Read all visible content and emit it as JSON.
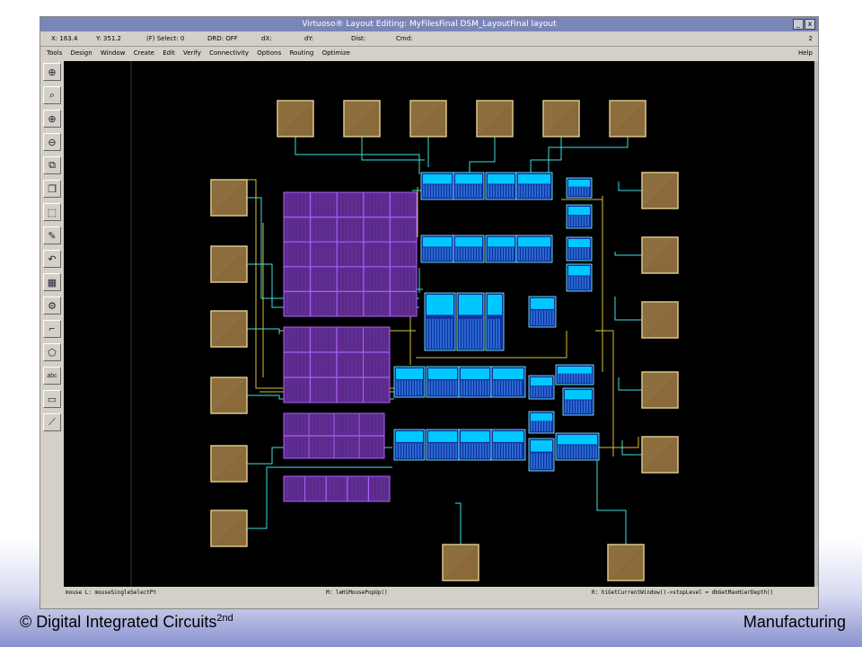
{
  "window": {
    "title": "Virtuoso® Layout Editing: MyFilesFinal DSM_LayoutFinal layout",
    "minimize_label": "_",
    "close_label": "x",
    "corner_number": "2"
  },
  "status": {
    "x": "X: 163.4",
    "y": "Y: 351.2",
    "select": "(F) Select: 0",
    "drd": "DRD: OFF",
    "dx": "dX:",
    "dy": "dY:",
    "dist": "Dist:",
    "cmd": "Cmd:"
  },
  "menu": {
    "items": [
      "Tools",
      "Design",
      "Window",
      "Create",
      "Edit",
      "Verify",
      "Connectivity",
      "Options",
      "Routing",
      "Optimize"
    ],
    "help": "Help"
  },
  "toolbar": {
    "tools": [
      {
        "name": "save-icon",
        "glyph": "⊕"
      },
      {
        "name": "zoom-fit-icon",
        "glyph": "⌕"
      },
      {
        "name": "zoom-in-icon",
        "glyph": "⊕"
      },
      {
        "name": "zoom-out-icon",
        "glyph": "⊖"
      },
      {
        "name": "stretch-icon",
        "glyph": "⧉"
      },
      {
        "name": "copy-icon",
        "glyph": "❐"
      },
      {
        "name": "move-icon",
        "glyph": "⬚"
      },
      {
        "name": "delete-icon",
        "glyph": "✎"
      },
      {
        "name": "undo-icon",
        "glyph": "↶"
      },
      {
        "name": "property-icon",
        "glyph": "▦"
      },
      {
        "name": "ruler-icon",
        "glyph": "⚙"
      },
      {
        "name": "path-icon",
        "glyph": "⌐"
      },
      {
        "name": "polygon-icon",
        "glyph": "⬠"
      },
      {
        "name": "label-icon",
        "glyph": "abc"
      },
      {
        "name": "rectangle-icon",
        "glyph": "▭"
      },
      {
        "name": "wire-icon",
        "glyph": "⟋"
      }
    ]
  },
  "mousebar": {
    "left": "mouse L: mouseSingleSelectPt",
    "middle": "M: leHiMousePopUp()",
    "right": "R: hiGetCurrentWindow()->stopLevel = dbGetMaxHierDepth()"
  },
  "footer": {
    "left_text": "© Digital Integrated Circuits",
    "left_sup": "2nd",
    "right_text": "Manufacturing"
  },
  "colors": {
    "canvas_bg": "#000000",
    "pad_fill": "#8a6a3a",
    "pad_border": "#d8c88a",
    "capacitor_fill": "#5a2a8a",
    "capacitor_grid": "#b060ff",
    "transistor_fill": "#00c8ff",
    "transistor_dark": "#1030a0",
    "wire_cyan": "#40e0e0",
    "wire_yellow": "#d8c040"
  }
}
